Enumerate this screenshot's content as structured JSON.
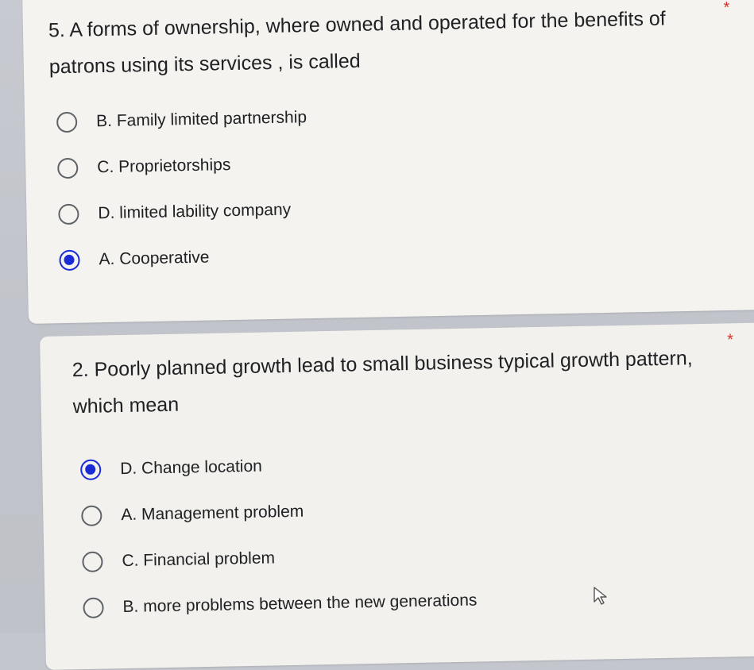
{
  "questions": [
    {
      "number_text": "5. A forms of ownership, where owned and operated for the benefits of patrons using its services , is called",
      "required_mark": "*",
      "options": [
        {
          "label": "B. Family limited partnership",
          "selected": false
        },
        {
          "label": "C. Proprietorships",
          "selected": false
        },
        {
          "label": "D. limited lability company",
          "selected": false
        },
        {
          "label": "A. Cooperative",
          "selected": true
        }
      ]
    },
    {
      "number_text": "2. Poorly planned growth lead to  small business typical growth pattern, which mean",
      "required_mark": "*",
      "options": [
        {
          "label": "D. Change location",
          "selected": true
        },
        {
          "label": "A. Management problem",
          "selected": false
        },
        {
          "label": "C. Financial problem",
          "selected": false
        },
        {
          "label": "B. more problems between the new generations",
          "selected": false
        }
      ]
    }
  ],
  "colors": {
    "accent": "#1a2bd6",
    "required": "#d93025",
    "text": "#202124",
    "card": "#f4f3ef"
  },
  "icons": {
    "cursor": "pointer-cursor-icon"
  }
}
